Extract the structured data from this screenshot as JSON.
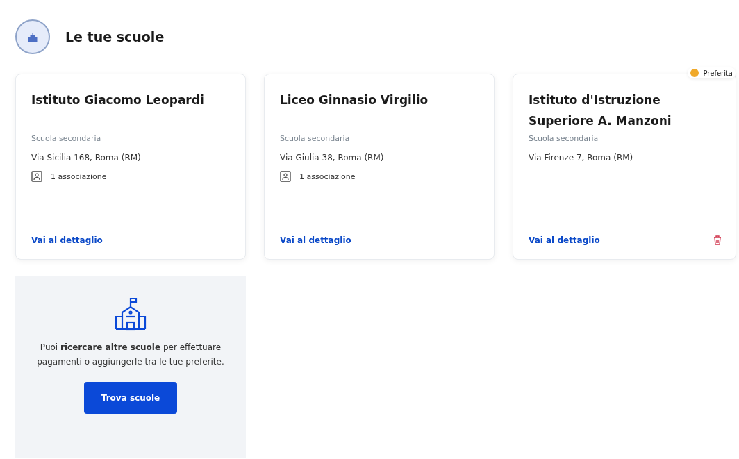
{
  "section": {
    "title": "Le tue scuole"
  },
  "schools": [
    {
      "name": "Istituto Giacomo Leopardi",
      "type": "Scuola secondaria",
      "address": "Via Sicilia 168, Roma (RM)",
      "associations": "1 associazione",
      "link": "Vai al dettaglio",
      "deletable": false
    },
    {
      "name": "Liceo Ginnasio Virgilio",
      "type": "Scuola secondaria",
      "address": "Via Giulia 38, Roma (RM)",
      "associations": "1 associazione",
      "link": "Vai al dettaglio",
      "deletable": false
    },
    {
      "name": "Istituto d'Istruzione Superiore A. Manzoni",
      "type": "Scuola secondaria",
      "address": "Via Firenze 7, Roma (RM)",
      "link": "Vai al dettaglio",
      "badge": "Preferita",
      "deletable": true
    }
  ],
  "search_card": {
    "text": "Puoi **ricercare altre scuole** per effettuare pagamenti o aggiungerle tra le tue preferite.",
    "button": "Trova scuole"
  }
}
